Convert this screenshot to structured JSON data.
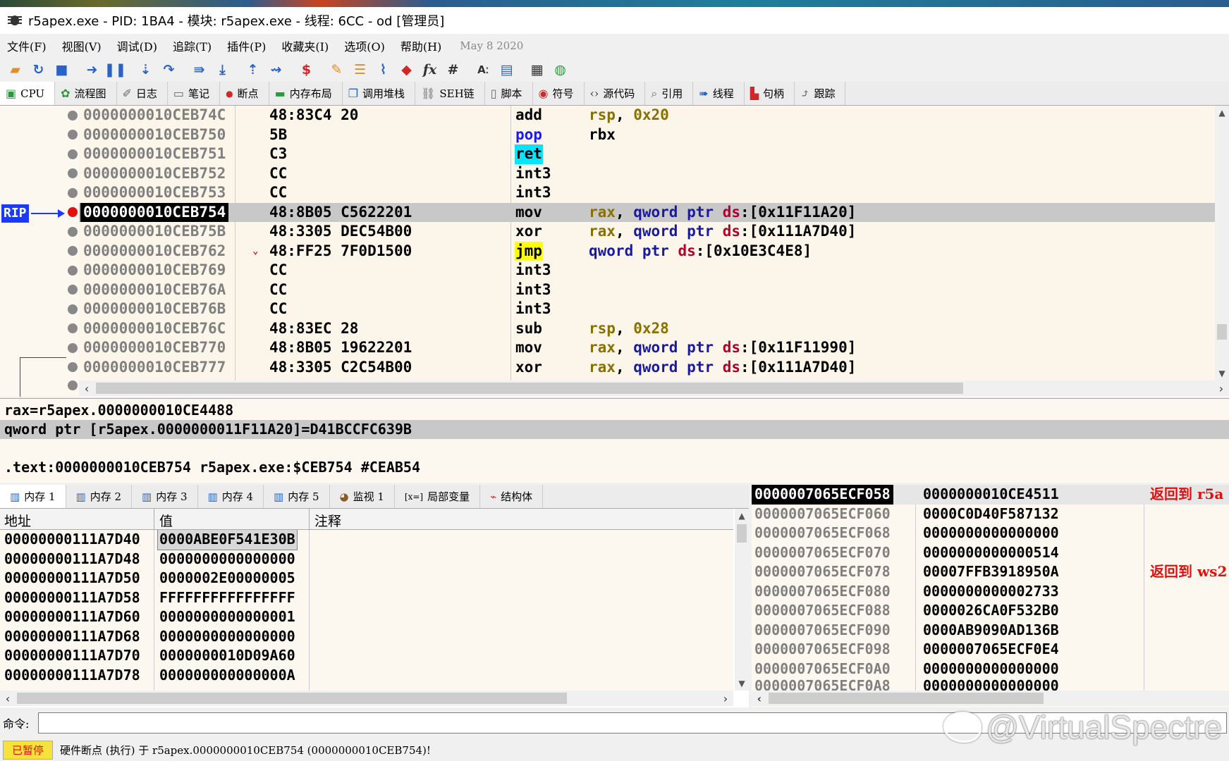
{
  "window": {
    "title": "r5apex.exe - PID: 1BA4 - 模块: r5apex.exe - 线程: 6CC - od [管理员]"
  },
  "menu": {
    "items": [
      "文件(F)",
      "视图(V)",
      "调试(D)",
      "追踪(T)",
      "插件(P)",
      "收藏夹(I)",
      "选项(O)",
      "帮助(H)"
    ],
    "date": "May 8 2020"
  },
  "toolbar": {
    "icons": [
      "open-icon",
      "restart-icon",
      "stop-icon",
      "run-icon",
      "pause-icon",
      "step-into-icon",
      "step-over-icon",
      "trace-into-icon",
      "trace-over-icon",
      "execute-till-return-icon",
      "run-to-user-code-icon",
      "script-icon",
      "patch-icon",
      "comment-icon",
      "label-icon",
      "bookmark-icon",
      "function-icon",
      "hash-icon",
      "font-icon",
      "copy-icon",
      "calculator-icon",
      "globe-icon"
    ]
  },
  "tabs": [
    {
      "label": "CPU",
      "icon": "cpu-icon",
      "active": true
    },
    {
      "label": "流程图",
      "icon": "graph-icon"
    },
    {
      "label": "日志",
      "icon": "log-icon"
    },
    {
      "label": "笔记",
      "icon": "notes-icon"
    },
    {
      "label": "断点",
      "icon": "breakpoint-icon"
    },
    {
      "label": "内存布局",
      "icon": "memory-map-icon"
    },
    {
      "label": "调用堆栈",
      "icon": "call-stack-icon"
    },
    {
      "label": "SEH链",
      "icon": "seh-icon"
    },
    {
      "label": "脚本",
      "icon": "script-icon"
    },
    {
      "label": "符号",
      "icon": "symbols-icon"
    },
    {
      "label": "源代码",
      "icon": "source-icon"
    },
    {
      "label": "引用",
      "icon": "references-icon"
    },
    {
      "label": "线程",
      "icon": "threads-icon"
    },
    {
      "label": "句柄",
      "icon": "handles-icon"
    },
    {
      "label": "跟踪",
      "icon": "trace-icon"
    }
  ],
  "disasm": {
    "rip_label": "RIP",
    "rows": [
      {
        "addr": "0000000010CEB74C",
        "bytes": "48:83C4 20",
        "mnem": "add",
        "ops": "rsp, 0x20"
      },
      {
        "addr": "0000000010CEB750",
        "bytes": "5B",
        "mnem": "pop",
        "ops": "rbx"
      },
      {
        "addr": "0000000010CEB751",
        "bytes": "C3",
        "mnem": "ret",
        "ops": ""
      },
      {
        "addr": "0000000010CEB752",
        "bytes": "CC",
        "mnem": "int3",
        "ops": ""
      },
      {
        "addr": "0000000010CEB753",
        "bytes": "CC",
        "mnem": "int3",
        "ops": ""
      },
      {
        "addr": "0000000010CEB754",
        "bytes": "48:8B05 C5622201",
        "mnem": "mov",
        "ops": "rax, qword ptr ds:[0x11F11A20]"
      },
      {
        "addr": "0000000010CEB75B",
        "bytes": "48:3305 DEC54B00",
        "mnem": "xor",
        "ops": "rax, qword ptr ds:[0x111A7D40]"
      },
      {
        "addr": "0000000010CEB762",
        "bytes": "48:FF25 7F0D1500",
        "mnem": "jmp",
        "ops": "qword ptr ds:[0x10E3C4E8]"
      },
      {
        "addr": "0000000010CEB769",
        "bytes": "CC",
        "mnem": "int3",
        "ops": ""
      },
      {
        "addr": "0000000010CEB76A",
        "bytes": "CC",
        "mnem": "int3",
        "ops": ""
      },
      {
        "addr": "0000000010CEB76B",
        "bytes": "CC",
        "mnem": "int3",
        "ops": ""
      },
      {
        "addr": "0000000010CEB76C",
        "bytes": "48:83EC 28",
        "mnem": "sub",
        "ops": "rsp, 0x28"
      },
      {
        "addr": "0000000010CEB770",
        "bytes": "48:8B05 19622201",
        "mnem": "mov",
        "ops": "rax, qword ptr ds:[0x11F11990]"
      },
      {
        "addr": "0000000010CEB777",
        "bytes": "48:3305 C2C54B00",
        "mnem": "xor",
        "ops": "rax, qword ptr ds:[0x111A7D40]"
      }
    ]
  },
  "info": {
    "line1": "rax=r5apex.0000000010CE4488",
    "line2": "qword ptr [r5apex.0000000011F11A20]=D41BCCFC639B",
    "line3": "",
    "line4": ".text:0000000010CEB754 r5apex.exe:$CEB754 #CEAB54"
  },
  "dump_tabs": [
    {
      "label": "内存 1",
      "icon": "memory-icon",
      "active": true
    },
    {
      "label": "内存 2",
      "icon": "memory-icon"
    },
    {
      "label": "内存 3",
      "icon": "memory-icon"
    },
    {
      "label": "内存 4",
      "icon": "memory-icon"
    },
    {
      "label": "内存 5",
      "icon": "memory-icon"
    },
    {
      "label": "监视 1",
      "icon": "watch-icon"
    },
    {
      "label": "局部变量",
      "icon": "locals-icon",
      "prefix": "[x=]"
    },
    {
      "label": "结构体",
      "icon": "struct-icon"
    }
  ],
  "dump": {
    "headers": {
      "addr": "地址",
      "value": "值",
      "comment": "注释"
    },
    "rows": [
      {
        "addr": "00000000111A7D40",
        "value": "0000ABE0F541E30B"
      },
      {
        "addr": "00000000111A7D48",
        "value": "0000000000000000"
      },
      {
        "addr": "00000000111A7D50",
        "value": "0000002E00000005"
      },
      {
        "addr": "00000000111A7D58",
        "value": "FFFFFFFFFFFFFFFF"
      },
      {
        "addr": "00000000111A7D60",
        "value": "0000000000000001"
      },
      {
        "addr": "00000000111A7D68",
        "value": "0000000000000000"
      },
      {
        "addr": "00000000111A7D70",
        "value": "0000000010D09A60"
      },
      {
        "addr": "00000000111A7D78",
        "value": "000000000000000A"
      }
    ]
  },
  "stack": {
    "rows": [
      {
        "addr": "0000007065ECF058",
        "value": "0000000010CE4511",
        "comment": "返回到 r5a"
      },
      {
        "addr": "0000007065ECF060",
        "value": "0000C0D40F587132",
        "comment": ""
      },
      {
        "addr": "0000007065ECF068",
        "value": "0000000000000000",
        "comment": ""
      },
      {
        "addr": "0000007065ECF070",
        "value": "0000000000000514",
        "comment": ""
      },
      {
        "addr": "0000007065ECF078",
        "value": "00007FFB3918950A",
        "comment": "返回到 ws2"
      },
      {
        "addr": "0000007065ECF080",
        "value": "0000000000002733",
        "comment": ""
      },
      {
        "addr": "0000007065ECF088",
        "value": "0000026CA0F532B0",
        "comment": ""
      },
      {
        "addr": "0000007065ECF090",
        "value": "0000AB9090AD136B",
        "comment": ""
      },
      {
        "addr": "0000007065ECF098",
        "value": "0000007065ECF0E4",
        "comment": ""
      },
      {
        "addr": "0000007065ECF0A0",
        "value": "0000000000000000",
        "comment": ""
      },
      {
        "addr": "0000007065ECF0A8",
        "value": "0000000000000000",
        "comment": ""
      }
    ]
  },
  "command": {
    "label": "命令:",
    "value": ""
  },
  "status": {
    "state": "已暂停",
    "message": "硬件断点 (执行) 于 r5apex.0000000010CEB754 (0000000010CEB754)!"
  },
  "watermark": {
    "text": "@VirtualSpectre"
  }
}
